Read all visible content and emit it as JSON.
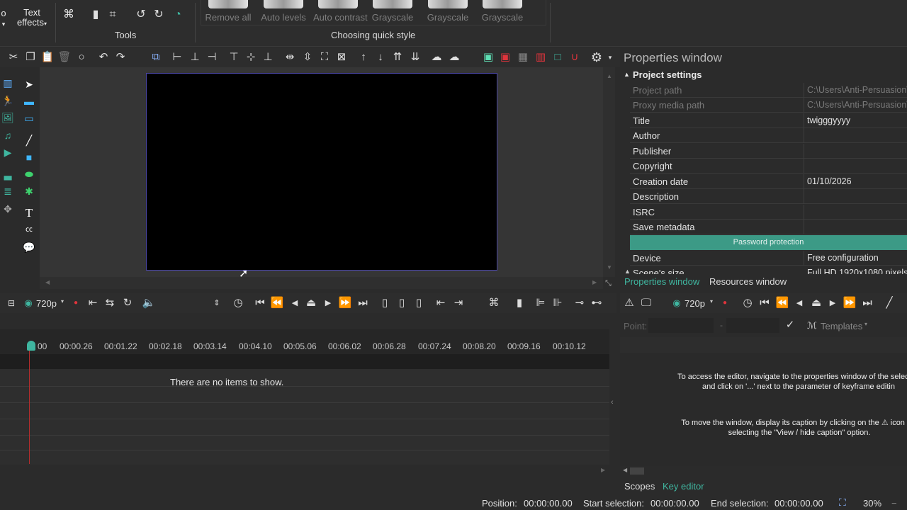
{
  "ribbon": {
    "partial_button_label": "o",
    "text_effects_label": "Text effects",
    "tools_group_label": "Tools",
    "styles_group_label": "Choosing quick style",
    "styles": [
      {
        "label": "Remove all"
      },
      {
        "label": "Auto levels"
      },
      {
        "label": "Auto contrast"
      },
      {
        "label": "Grayscale"
      },
      {
        "label": "Grayscale"
      },
      {
        "label": "Grayscale"
      }
    ]
  },
  "properties": {
    "window_title": "Properties window",
    "section_title": "Project settings",
    "rows": [
      {
        "key": "Project path",
        "value": "C:\\Users\\Anti-Persuasion\\",
        "dim": true
      },
      {
        "key": "Proxy media path",
        "value": "C:\\Users\\Anti-Persuasion\\",
        "dim": true
      },
      {
        "key": "Title",
        "value": "twigggyyyy",
        "dim": false
      },
      {
        "key": "Author",
        "value": "",
        "dim": false
      },
      {
        "key": "Publisher",
        "value": "",
        "dim": false
      },
      {
        "key": "Copyright",
        "value": "",
        "dim": false
      },
      {
        "key": "Creation date",
        "value": "01/10/2026",
        "dim": false
      },
      {
        "key": "Description",
        "value": "",
        "dim": false
      },
      {
        "key": "ISRC",
        "value": "",
        "dim": false
      },
      {
        "key": "Save metadata",
        "value": "",
        "dim": false
      }
    ],
    "password_button": "Password protection",
    "device_key": "Device",
    "device_value": "Free configuration",
    "scene_size_key": "Scene's size",
    "scene_size_value": "Full HD 1920x1080 pixels",
    "tabs": [
      "Properties window",
      "Resources window"
    ]
  },
  "timeline": {
    "resolution": "720p",
    "ticks": [
      "00",
      "00:00.26",
      "00:01.22",
      "00:02.18",
      "00:03.14",
      "00:04.10",
      "00:05.06",
      "00:06.02",
      "00:06.28",
      "00:07.24",
      "00:08.20",
      "00:09.16",
      "00:10.12"
    ],
    "empty_message": "There are no items to show."
  },
  "key_editor": {
    "resolution": "720p",
    "point_label": "Point:",
    "templates_label": "Templates",
    "message1_line1": "To access the editor, navigate to the properties window of the selected",
    "message1_line2": "and click on '...' next to the parameter of keyframe editin",
    "message2_line1": "To move the window, display its caption by clicking on the",
    "message2_line1b": "icon in t",
    "message2_line2": "selecting the \"View / hide caption\" option.",
    "tabs": [
      "Scopes",
      "Key editor"
    ]
  },
  "status": {
    "position_label": "Position:",
    "position_value": "00:00:00.00",
    "start_label": "Start selection:",
    "start_value": "00:00:00.00",
    "end_label": "End selection:",
    "end_value": "00:00:00.00",
    "zoom": "30%"
  },
  "colors": {
    "accent_teal": "#3c9a86",
    "tab_active": "#3fb6a0",
    "record_red": "#e0343c",
    "preview_border": "#4a46a6"
  }
}
